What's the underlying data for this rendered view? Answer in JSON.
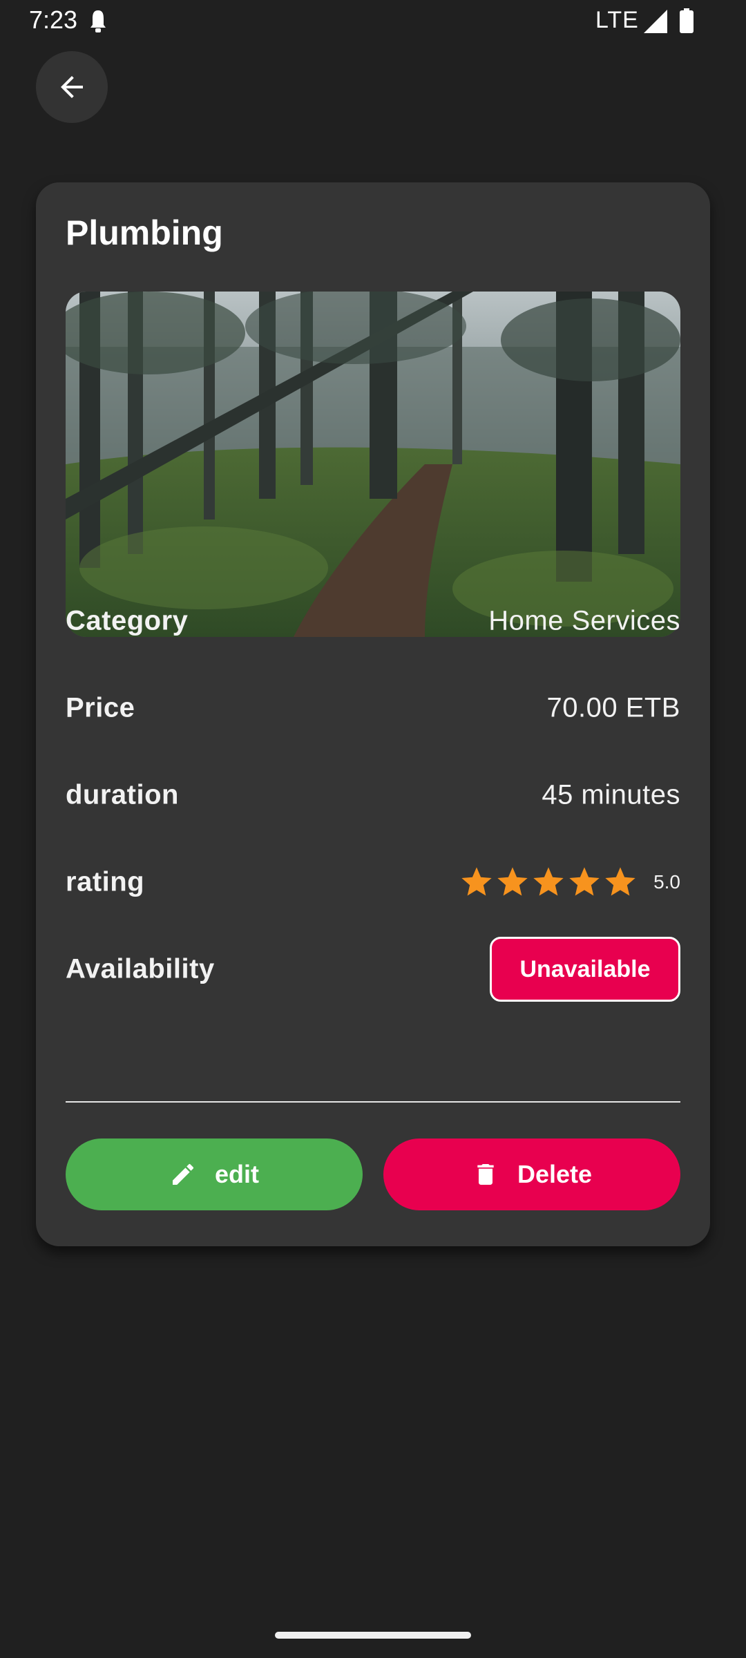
{
  "status_bar": {
    "time": "7:23",
    "network": "LTE",
    "icons": [
      "alarm-icon",
      "signal-icon",
      "battery-icon"
    ]
  },
  "nav": {
    "back_icon": "arrow-left-icon"
  },
  "service": {
    "title": "Plumbing",
    "image_icon": "forest-path-photo",
    "details": {
      "category_label": "Category",
      "category_value": "Home Services",
      "price_label": "Price",
      "price_value": "70.00 ETB",
      "duration_label": "duration",
      "duration_value": "45 minutes",
      "rating_label": "rating",
      "rating_value": "5.0",
      "rating_stars": 5,
      "availability_label": "Availability",
      "availability_value": "Unavailable"
    },
    "actions": {
      "edit_label": "edit",
      "edit_icon": "pencil-icon",
      "delete_label": "Delete",
      "delete_icon": "trash-icon"
    }
  },
  "colors": {
    "background": "#202020",
    "card": "#353535",
    "accent_green": "#4caf50",
    "accent_red": "#e8004f",
    "star": "#f7931e"
  }
}
